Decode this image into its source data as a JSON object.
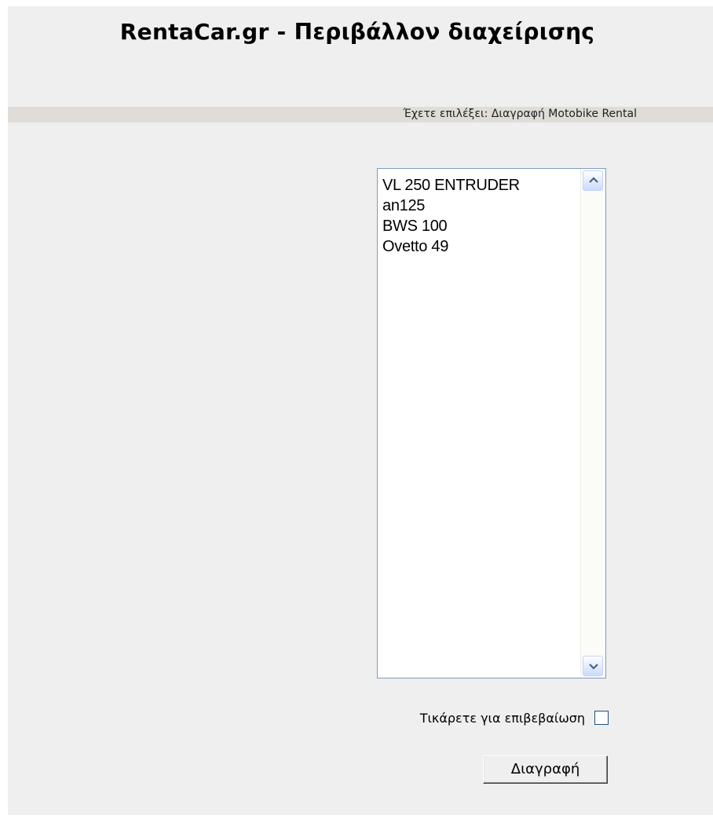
{
  "header": {
    "title": "RentaCar.gr - Περιβάλλον διαχείρισης"
  },
  "selection_bar": {
    "text": "Έχετε επιλέξει: Διαγραφή Motobike Rental"
  },
  "listbox": {
    "items": [
      {
        "label": "VL 250 ENTRUDER"
      },
      {
        "label": "an125"
      },
      {
        "label": "BWS 100"
      },
      {
        "label": "Ovetto 49"
      }
    ]
  },
  "confirm": {
    "label": "Τικάρετε για επιβεβαίωση",
    "checked": false
  },
  "actions": {
    "delete_label": "Διαγραφή"
  },
  "icons": {
    "scroll_up": "chevron-up-icon",
    "scroll_down": "chevron-down-icon"
  },
  "colors": {
    "page_background": "#efefef",
    "selection_bar": "#e0ddd9",
    "listbox_border": "#7f9db9",
    "scroll_button": "#cbdbfc"
  }
}
